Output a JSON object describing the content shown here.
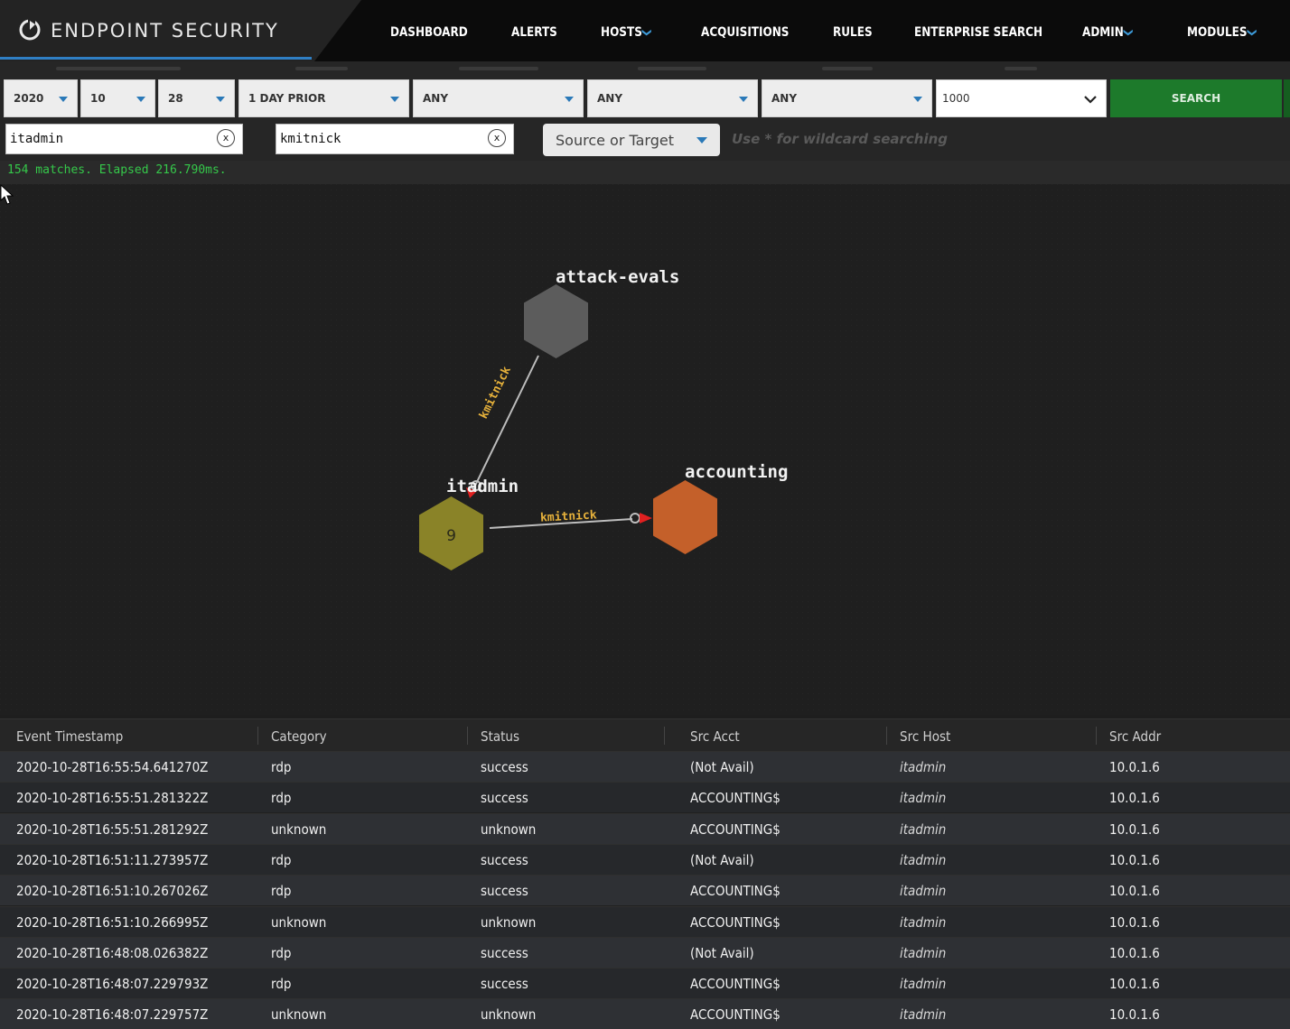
{
  "brand": {
    "title": "ENDPOINT SECURITY"
  },
  "nav": [
    {
      "label": "DASHBOARD",
      "caret": ""
    },
    {
      "label": "ALERTS",
      "caret": ""
    },
    {
      "label": "HOSTS",
      "caret": "❯"
    },
    {
      "label": "ACQUISITIONS",
      "caret": ""
    },
    {
      "label": "RULES",
      "caret": ""
    },
    {
      "label": "ENTERPRISE SEARCH",
      "caret": ""
    },
    {
      "label": "ADMIN",
      "caret": "❯"
    },
    {
      "label": "MODULES",
      "caret": "❯"
    }
  ],
  "filters": {
    "year": "2020",
    "month": "10",
    "day": "28",
    "period": "1 DAY PRIOR",
    "privileges": "ANY",
    "category": "ANY",
    "status": "ANY",
    "limit": "1000",
    "search_label": "SEARCH"
  },
  "search": {
    "source_value": "itadmin",
    "target_value": "kmitnick",
    "clear_glyph": "x",
    "mode": "Source or Target",
    "hint": "Use * for wildcard searching"
  },
  "status_line": "154 matches. Elapsed 216.790ms.",
  "graph": {
    "nodes": [
      {
        "label": "attack-evals",
        "count": "",
        "color": "#5c5c5c"
      },
      {
        "label": "itadmin",
        "count": "9",
        "color": "#8a8328"
      },
      {
        "label": "accounting",
        "count": "",
        "color": "#c4602a"
      }
    ],
    "edges": [
      {
        "label": "kmitnick"
      },
      {
        "label": "kmitnick"
      }
    ],
    "colors": {
      "edge": "#bdbdbd",
      "arrow": "#e02020",
      "edge_label": "#e6b13b"
    }
  },
  "table": {
    "columns": [
      "Event Timestamp",
      "Category",
      "Status",
      "Src Acct",
      "Src Host",
      "Src Addr"
    ],
    "rows": [
      [
        "2020-10-28T16:55:54.641270Z",
        "rdp",
        "success",
        "(Not Avail)",
        "itadmin",
        "10.0.1.6"
      ],
      [
        "2020-10-28T16:55:51.281322Z",
        "rdp",
        "success",
        "ACCOUNTING$",
        "itadmin",
        "10.0.1.6"
      ],
      [
        "2020-10-28T16:55:51.281292Z",
        "unknown",
        "unknown",
        "ACCOUNTING$",
        "itadmin",
        "10.0.1.6"
      ],
      [
        "2020-10-28T16:51:11.273957Z",
        "rdp",
        "success",
        "(Not Avail)",
        "itadmin",
        "10.0.1.6"
      ],
      [
        "2020-10-28T16:51:10.267026Z",
        "rdp",
        "success",
        "ACCOUNTING$",
        "itadmin",
        "10.0.1.6"
      ],
      [
        "2020-10-28T16:51:10.266995Z",
        "unknown",
        "unknown",
        "ACCOUNTING$",
        "itadmin",
        "10.0.1.6"
      ],
      [
        "2020-10-28T16:48:08.026382Z",
        "rdp",
        "success",
        "(Not Avail)",
        "itadmin",
        "10.0.1.6"
      ],
      [
        "2020-10-28T16:48:07.229793Z",
        "rdp",
        "success",
        "ACCOUNTING$",
        "itadmin",
        "10.0.1.6"
      ],
      [
        "2020-10-28T16:48:07.229757Z",
        "unknown",
        "unknown",
        "ACCOUNTING$",
        "itadmin",
        "10.0.1.6"
      ]
    ]
  }
}
